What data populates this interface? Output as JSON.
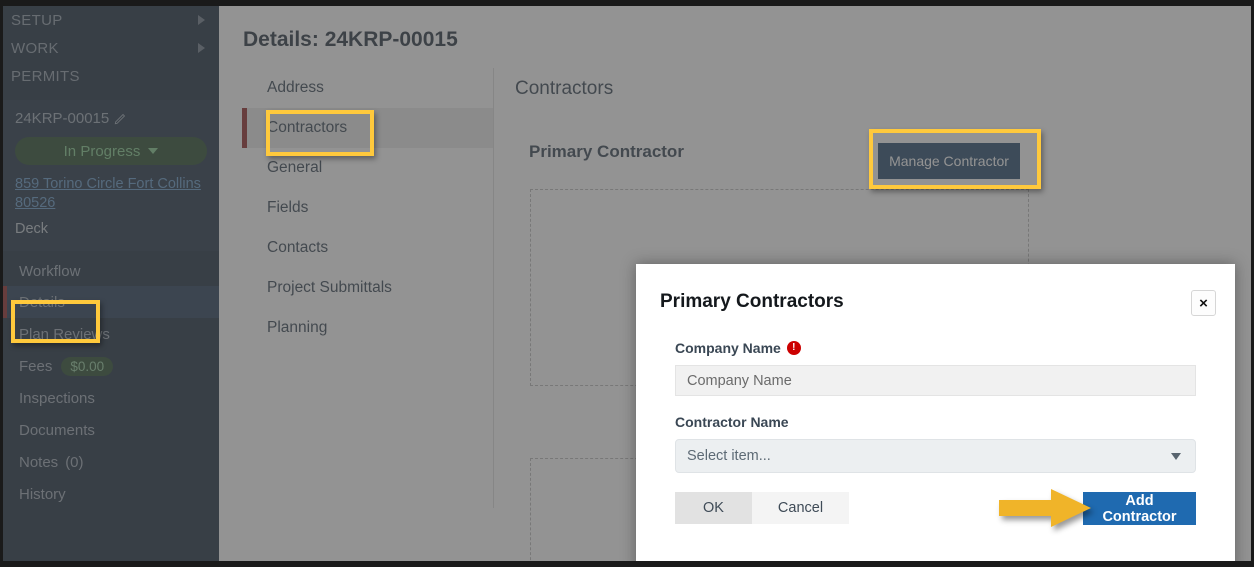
{
  "sidebar": {
    "top_items": [
      {
        "label": "SETUP",
        "has_caret": true,
        "icon": "chevron-right-icon"
      },
      {
        "label": "WORK",
        "has_caret": true,
        "icon": "chevron-right-icon"
      },
      {
        "label": "PERMITS",
        "has_caret": false,
        "icon": ""
      }
    ],
    "permit_number": "24KRP-00015",
    "edit_icon": "pencil-icon",
    "status": "In Progress",
    "status_caret_icon": "chevron-down-icon",
    "address": "859 Torino Circle Fort Collins 80526",
    "work_type": "Deck",
    "section_title": "Workflow",
    "nav_items": [
      {
        "label": "Details",
        "badge": "",
        "active": true
      },
      {
        "label": "Plan Reviews",
        "badge": "",
        "active": false
      },
      {
        "label": "Fees",
        "badge": "$0.00",
        "active": false
      },
      {
        "label": "Inspections",
        "badge": "",
        "active": false
      },
      {
        "label": "Documents",
        "badge": "",
        "active": false
      },
      {
        "label": "Notes",
        "badge": "",
        "count": "(0)",
        "active": false
      },
      {
        "label": "History",
        "badge": "",
        "active": false
      }
    ],
    "colors": {
      "background": "#102236",
      "card_background": "#17293d",
      "active_row": "#1b3350",
      "accent_bar": "#8b1d1d",
      "status_green_bg": "#1d4322",
      "status_green_text": "#7ec98a",
      "link": "#5d93c4"
    }
  },
  "main": {
    "page_title": "Details: 24KRP-00015",
    "subnav_items": [
      {
        "label": "Address",
        "active": false
      },
      {
        "label": "Contractors",
        "active": true
      },
      {
        "label": "General",
        "active": false
      },
      {
        "label": "Fields",
        "active": false
      },
      {
        "label": "Contacts",
        "active": false
      },
      {
        "label": "Project Submittals",
        "active": false
      },
      {
        "label": "Planning",
        "active": false
      }
    ],
    "section_heading": "Contractors",
    "primary_contractor_label": "Primary Contractor",
    "manage_contractor_button": "Manage Contractor"
  },
  "modal": {
    "title": "Primary Contractors",
    "close_icon": "close-icon",
    "close_label": "×",
    "company_name_label": "Company Name",
    "company_required_icon": "required-exclamation-icon",
    "company_required_glyph": "!",
    "company_name_placeholder": "Company Name",
    "company_name_value": "",
    "contractor_name_label": "Contractor Name",
    "contractor_select_value": "Select item...",
    "contractor_select_caret_icon": "chevron-down-icon",
    "ok_button": "OK",
    "cancel_button": "Cancel",
    "add_contractor_button": "Add Contractor",
    "colors": {
      "primary_button": "#1f6ab0",
      "input_background": "#f1f1f1",
      "select_background": "#eceff1"
    }
  },
  "annotations": {
    "highlight_color": "#ffc93c",
    "arrow_color": "#f0b429",
    "highlight_targets": [
      "Details",
      "Contractors",
      "Manage Contractor"
    ],
    "arrow_target": "Add Contractor"
  }
}
